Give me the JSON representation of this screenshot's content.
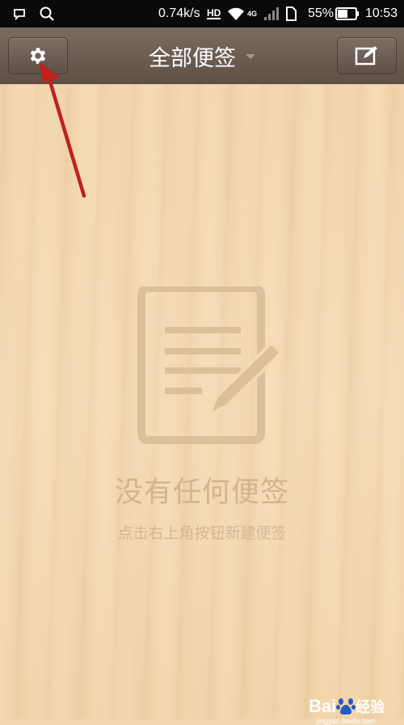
{
  "status_bar": {
    "network_speed": "0.74k/s",
    "hd_badge": "HD",
    "network_type": "4G",
    "battery_percent": "55%",
    "time": "10:53",
    "icons": [
      "message-icon",
      "search-icon",
      "hd-icon",
      "wifi-icon",
      "signal-icon",
      "sim-icon",
      "battery-icon"
    ]
  },
  "header": {
    "title": "全部便签",
    "settings_icon": "gear-icon",
    "new_note_icon": "compose-icon"
  },
  "empty_state": {
    "icon": "note-edit-icon",
    "title": "没有任何便签",
    "hint": "点击右上角按钮新建便签"
  },
  "watermark": {
    "brand": "Bai",
    "brand_cn": "经验",
    "sub": "jingyan.baidu.com"
  },
  "colors": {
    "header": "#6b5c51",
    "annotation_arrow": "#c0201e",
    "empty_text": "#d2b48e"
  }
}
